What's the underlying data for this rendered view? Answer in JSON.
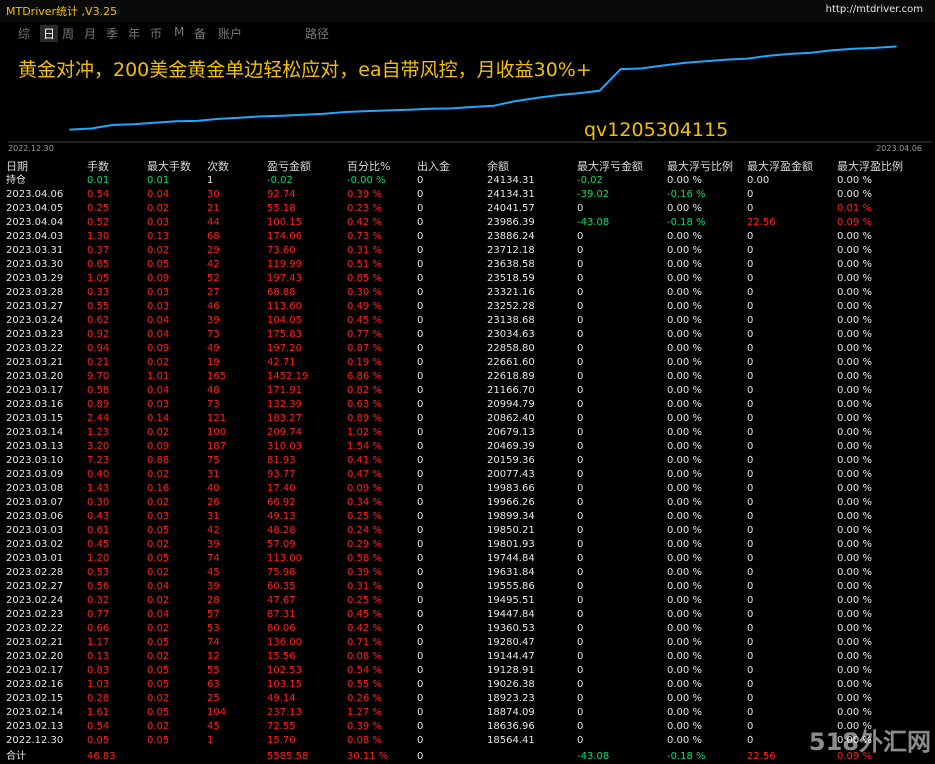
{
  "title": "MTDriver统计 ,V3.25",
  "site": "http://mtdriver.com",
  "tabs": [
    {
      "label": "综",
      "active": false
    },
    {
      "label": "日",
      "active": true
    },
    {
      "label": "周",
      "active": false
    },
    {
      "label": "月",
      "active": false
    },
    {
      "label": "季",
      "active": false
    },
    {
      "label": "年",
      "active": false
    },
    {
      "label": "币",
      "active": false
    },
    {
      "label": "M",
      "active": false
    },
    {
      "label": "备",
      "active": false
    },
    {
      "label": "账户",
      "active": false
    },
    {
      "label": "路径",
      "active": false
    }
  ],
  "chart": {
    "headline": "黄金对冲，200美金黄金单边轻松应对，ea自带风控，月收益30%+",
    "contact": "qv1205304115",
    "date_start": "2022.12.30",
    "date_end": "2023.04.06",
    "line_color": "#1ea8ff"
  },
  "chart_data": {
    "type": "line",
    "x": [
      "2022.12.30",
      "2023.02.13",
      "2023.02.14",
      "2023.02.15",
      "2023.02.16",
      "2023.02.17",
      "2023.02.20",
      "2023.02.21",
      "2023.02.22",
      "2023.02.23",
      "2023.02.24",
      "2023.02.27",
      "2023.02.28",
      "2023.03.01",
      "2023.03.02",
      "2023.03.03",
      "2023.03.06",
      "2023.03.07",
      "2023.03.08",
      "2023.03.09",
      "2023.03.10",
      "2023.03.13",
      "2023.03.14",
      "2023.03.15",
      "2023.03.16",
      "2023.03.17",
      "2023.03.20",
      "2023.03.21",
      "2023.03.22",
      "2023.03.23",
      "2023.03.24",
      "2023.03.27",
      "2023.03.28",
      "2023.03.29",
      "2023.03.30",
      "2023.03.31",
      "2023.04.03",
      "2023.04.04",
      "2023.04.05",
      "2023.04.06"
    ],
    "series": [
      {
        "values": [
          18564.41,
          18636.96,
          18874.09,
          18923.23,
          19026.38,
          19128.91,
          19144.47,
          19280.47,
          19360.53,
          19447.84,
          19495.51,
          19555.86,
          19631.84,
          19744.84,
          19801.93,
          19850.21,
          19899.34,
          19966.26,
          19983.66,
          20077.43,
          20159.36,
          20469.39,
          20679.13,
          20862.4,
          20994.79,
          21166.7,
          22618.89,
          22661.6,
          22858.8,
          23034.63,
          23138.68,
          23252.28,
          23321.16,
          23518.59,
          23638.58,
          23712.18,
          23886.24,
          23986.39,
          24041.57,
          24134.31
        ]
      }
    ]
  },
  "columns": [
    "日期",
    "手数",
    "最大手数",
    "次数",
    "盈亏金额",
    "百分比%",
    "出入金",
    "余额",
    "最大浮亏金额",
    "最大浮亏比例",
    "最大浮盈金额",
    "最大浮盈比例"
  ],
  "position_row": {
    "date": "持仓",
    "lots": "0.01",
    "max_lots": "0.01",
    "count": "1",
    "pnl": "-0.02",
    "pct": "-0.00 %",
    "io": "0",
    "balance": "24134.31",
    "max_dd_amt": "-0.02",
    "max_dd_pct": "0.00 %",
    "max_fp_amt": "0.00",
    "max_fp_pct": "0.00 %"
  },
  "rows": [
    {
      "date": "2023.04.06",
      "lots": "0.54",
      "max_lots": "0.04",
      "count": "30",
      "pnl": "92.74",
      "pct": "0.39 %",
      "io": "0",
      "balance": "24134.31",
      "max_dd_amt": "-39.02",
      "max_dd_pct": "-0.16 %",
      "max_fp_amt": "0",
      "max_fp_pct": "0.00 %"
    },
    {
      "date": "2023.04.05",
      "lots": "0.25",
      "max_lots": "0.02",
      "count": "21",
      "pnl": "55.18",
      "pct": "0.23 %",
      "io": "0",
      "balance": "24041.57",
      "max_dd_amt": "0",
      "max_dd_pct": "0.00 %",
      "max_fp_amt": "0",
      "max_fp_pct": "0.01 %"
    },
    {
      "date": "2023.04.04",
      "lots": "0.52",
      "max_lots": "0.03",
      "count": "44",
      "pnl": "100.15",
      "pct": "0.42 %",
      "io": "0",
      "balance": "23986.39",
      "max_dd_amt": "-43.08",
      "max_dd_pct": "-0.18 %",
      "max_fp_amt": "22.56",
      "max_fp_pct": "0.09 %"
    },
    {
      "date": "2023.04.03",
      "lots": "1.30",
      "max_lots": "0.13",
      "count": "68",
      "pnl": "174.06",
      "pct": "0.73 %",
      "io": "0",
      "balance": "23886.24",
      "max_dd_amt": "0",
      "max_dd_pct": "0.00 %",
      "max_fp_amt": "0",
      "max_fp_pct": "0.00 %"
    },
    {
      "date": "2023.03.31",
      "lots": "0.37",
      "max_lots": "0.02",
      "count": "29",
      "pnl": "73.60",
      "pct": "0.31 %",
      "io": "0",
      "balance": "23712.18",
      "max_dd_amt": "0",
      "max_dd_pct": "0.00 %",
      "max_fp_amt": "0",
      "max_fp_pct": "0.00 %"
    },
    {
      "date": "2023.03.30",
      "lots": "0.65",
      "max_lots": "0.05",
      "count": "42",
      "pnl": "119.99",
      "pct": "0.51 %",
      "io": "0",
      "balance": "23638.58",
      "max_dd_amt": "0",
      "max_dd_pct": "0.00 %",
      "max_fp_amt": "0",
      "max_fp_pct": "0.00 %"
    },
    {
      "date": "2023.03.29",
      "lots": "1.05",
      "max_lots": "0.09",
      "count": "52",
      "pnl": "197.43",
      "pct": "0.85 %",
      "io": "0",
      "balance": "23518.59",
      "max_dd_amt": "0",
      "max_dd_pct": "0.00 %",
      "max_fp_amt": "0",
      "max_fp_pct": "0.00 %"
    },
    {
      "date": "2023.03.28",
      "lots": "0.33",
      "max_lots": "0.03",
      "count": "27",
      "pnl": "68.88",
      "pct": "0.30 %",
      "io": "0",
      "balance": "23321.16",
      "max_dd_amt": "0",
      "max_dd_pct": "0.00 %",
      "max_fp_amt": "0",
      "max_fp_pct": "0.00 %"
    },
    {
      "date": "2023.03.27",
      "lots": "0.55",
      "max_lots": "0.03",
      "count": "46",
      "pnl": "113.60",
      "pct": "0.49 %",
      "io": "0",
      "balance": "23252.28",
      "max_dd_amt": "0",
      "max_dd_pct": "0.00 %",
      "max_fp_amt": "0",
      "max_fp_pct": "0.00 %"
    },
    {
      "date": "2023.03.24",
      "lots": "0.62",
      "max_lots": "0.04",
      "count": "39",
      "pnl": "104.05",
      "pct": "0.45 %",
      "io": "0",
      "balance": "23138.68",
      "max_dd_amt": "0",
      "max_dd_pct": "0.00 %",
      "max_fp_amt": "0",
      "max_fp_pct": "0.00 %"
    },
    {
      "date": "2023.03.23",
      "lots": "0.92",
      "max_lots": "0.04",
      "count": "73",
      "pnl": "175.83",
      "pct": "0.77 %",
      "io": "0",
      "balance": "23034.63",
      "max_dd_amt": "0",
      "max_dd_pct": "0.00 %",
      "max_fp_amt": "0",
      "max_fp_pct": "0.00 %"
    },
    {
      "date": "2023.03.22",
      "lots": "0.94",
      "max_lots": "0.09",
      "count": "49",
      "pnl": "197.20",
      "pct": "0.87 %",
      "io": "0",
      "balance": "22858.80",
      "max_dd_amt": "0",
      "max_dd_pct": "0.00 %",
      "max_fp_amt": "0",
      "max_fp_pct": "0.00 %"
    },
    {
      "date": "2023.03.21",
      "lots": "0.21",
      "max_lots": "0.02",
      "count": "19",
      "pnl": "42.71",
      "pct": "0.19 %",
      "io": "0",
      "balance": "22661.60",
      "max_dd_amt": "0",
      "max_dd_pct": "0.00 %",
      "max_fp_amt": "0",
      "max_fp_pct": "0.00 %"
    },
    {
      "date": "2023.03.20",
      "lots": "9.70",
      "max_lots": "1.01",
      "count": "165",
      "pnl": "1452.19",
      "pct": "6.86 %",
      "io": "0",
      "balance": "22618.89",
      "max_dd_amt": "0",
      "max_dd_pct": "0.00 %",
      "max_fp_amt": "0",
      "max_fp_pct": "0.00 %"
    },
    {
      "date": "2023.03.17",
      "lots": "0.58",
      "max_lots": "0.04",
      "count": "48",
      "pnl": "171.91",
      "pct": "0.82 %",
      "io": "0",
      "balance": "21166.70",
      "max_dd_amt": "0",
      "max_dd_pct": "0.00 %",
      "max_fp_amt": "0",
      "max_fp_pct": "0.00 %"
    },
    {
      "date": "2023.03.16",
      "lots": "0.89",
      "max_lots": "0.03",
      "count": "73",
      "pnl": "132.39",
      "pct": "0.63 %",
      "io": "0",
      "balance": "20994.79",
      "max_dd_amt": "0",
      "max_dd_pct": "0.00 %",
      "max_fp_amt": "0",
      "max_fp_pct": "0.00 %"
    },
    {
      "date": "2023.03.15",
      "lots": "2.44",
      "max_lots": "0.14",
      "count": "121",
      "pnl": "183.27",
      "pct": "0.89 %",
      "io": "0",
      "balance": "20862.40",
      "max_dd_amt": "0",
      "max_dd_pct": "0.00 %",
      "max_fp_amt": "0",
      "max_fp_pct": "0.00 %"
    },
    {
      "date": "2023.03.14",
      "lots": "1.23",
      "max_lots": "0.02",
      "count": "100",
      "pnl": "209.74",
      "pct": "1.02 %",
      "io": "0",
      "balance": "20679.13",
      "max_dd_amt": "0",
      "max_dd_pct": "0.00 %",
      "max_fp_amt": "0",
      "max_fp_pct": "0.00 %"
    },
    {
      "date": "2023.03.13",
      "lots": "3.20",
      "max_lots": "0.09",
      "count": "187",
      "pnl": "310.03",
      "pct": "1.54 %",
      "io": "0",
      "balance": "20469.39",
      "max_dd_amt": "0",
      "max_dd_pct": "0.00 %",
      "max_fp_amt": "0",
      "max_fp_pct": "0.00 %"
    },
    {
      "date": "2023.03.10",
      "lots": "7.23",
      "max_lots": "0.88",
      "count": "75",
      "pnl": "81.93",
      "pct": "0.41 %",
      "io": "0",
      "balance": "20159.36",
      "max_dd_amt": "0",
      "max_dd_pct": "0.00 %",
      "max_fp_amt": "0",
      "max_fp_pct": "0.00 %"
    },
    {
      "date": "2023.03.09",
      "lots": "0.40",
      "max_lots": "0.02",
      "count": "31",
      "pnl": "93.77",
      "pct": "0.47 %",
      "io": "0",
      "balance": "20077.43",
      "max_dd_amt": "0",
      "max_dd_pct": "0.00 %",
      "max_fp_amt": "0",
      "max_fp_pct": "0.00 %"
    },
    {
      "date": "2023.03.08",
      "lots": "1.43",
      "max_lots": "0.16",
      "count": "40",
      "pnl": "17.40",
      "pct": "0.09 %",
      "io": "0",
      "balance": "19983.66",
      "max_dd_amt": "0",
      "max_dd_pct": "0.00 %",
      "max_fp_amt": "0",
      "max_fp_pct": "0.00 %"
    },
    {
      "date": "2023.03.07",
      "lots": "0.30",
      "max_lots": "0.02",
      "count": "26",
      "pnl": "66.92",
      "pct": "0.34 %",
      "io": "0",
      "balance": "19966.26",
      "max_dd_amt": "0",
      "max_dd_pct": "0.00 %",
      "max_fp_amt": "0",
      "max_fp_pct": "0.00 %"
    },
    {
      "date": "2023.03.06",
      "lots": "0.43",
      "max_lots": "0.03",
      "count": "31",
      "pnl": "49.13",
      "pct": "0.25 %",
      "io": "0",
      "balance": "19899.34",
      "max_dd_amt": "0",
      "max_dd_pct": "0.00 %",
      "max_fp_amt": "0",
      "max_fp_pct": "0.00 %"
    },
    {
      "date": "2023.03.03",
      "lots": "0.61",
      "max_lots": "0.05",
      "count": "42",
      "pnl": "48.28",
      "pct": "0.24 %",
      "io": "0",
      "balance": "19850.21",
      "max_dd_amt": "0",
      "max_dd_pct": "0.00 %",
      "max_fp_amt": "0",
      "max_fp_pct": "0.00 %"
    },
    {
      "date": "2023.03.02",
      "lots": "0.45",
      "max_lots": "0.02",
      "count": "39",
      "pnl": "57.09",
      "pct": "0.29 %",
      "io": "0",
      "balance": "19801.93",
      "max_dd_amt": "0",
      "max_dd_pct": "0.00 %",
      "max_fp_amt": "0",
      "max_fp_pct": "0.00 %"
    },
    {
      "date": "2023.03.01",
      "lots": "1.20",
      "max_lots": "0.05",
      "count": "74",
      "pnl": "113.00",
      "pct": "0.58 %",
      "io": "0",
      "balance": "19744.84",
      "max_dd_amt": "0",
      "max_dd_pct": "0.00 %",
      "max_fp_amt": "0",
      "max_fp_pct": "0.00 %"
    },
    {
      "date": "2023.02.28",
      "lots": "0.53",
      "max_lots": "0.02",
      "count": "45",
      "pnl": "75.98",
      "pct": "0.39 %",
      "io": "0",
      "balance": "19631.84",
      "max_dd_amt": "0",
      "max_dd_pct": "0.00 %",
      "max_fp_amt": "0",
      "max_fp_pct": "0.00 %"
    },
    {
      "date": "2023.02.27",
      "lots": "0.56",
      "max_lots": "0.04",
      "count": "39",
      "pnl": "60.35",
      "pct": "0.31 %",
      "io": "0",
      "balance": "19555.86",
      "max_dd_amt": "0",
      "max_dd_pct": "0.00 %",
      "max_fp_amt": "0",
      "max_fp_pct": "0.00 %"
    },
    {
      "date": "2023.02.24",
      "lots": "0.32",
      "max_lots": "0.02",
      "count": "28",
      "pnl": "47.67",
      "pct": "0.25 %",
      "io": "0",
      "balance": "19495.51",
      "max_dd_amt": "0",
      "max_dd_pct": "0.00 %",
      "max_fp_amt": "0",
      "max_fp_pct": "0.00 %"
    },
    {
      "date": "2023.02.23",
      "lots": "0.77",
      "max_lots": "0.04",
      "count": "57",
      "pnl": "87.31",
      "pct": "0.45 %",
      "io": "0",
      "balance": "19447.84",
      "max_dd_amt": "0",
      "max_dd_pct": "0.00 %",
      "max_fp_amt": "0",
      "max_fp_pct": "0.00 %"
    },
    {
      "date": "2023.02.22",
      "lots": "0.66",
      "max_lots": "0.02",
      "count": "53",
      "pnl": "80.06",
      "pct": "0.42 %",
      "io": "0",
      "balance": "19360.53",
      "max_dd_amt": "0",
      "max_dd_pct": "0.00 %",
      "max_fp_amt": "0",
      "max_fp_pct": "0.00 %"
    },
    {
      "date": "2023.02.21",
      "lots": "1.17",
      "max_lots": "0.05",
      "count": "74",
      "pnl": "136.00",
      "pct": "0.71 %",
      "io": "0",
      "balance": "19280.47",
      "max_dd_amt": "0",
      "max_dd_pct": "0.00 %",
      "max_fp_amt": "0",
      "max_fp_pct": "0.00 %"
    },
    {
      "date": "2023.02.20",
      "lots": "0.13",
      "max_lots": "0.02",
      "count": "12",
      "pnl": "15.56",
      "pct": "0.08 %",
      "io": "0",
      "balance": "19144.47",
      "max_dd_amt": "0",
      "max_dd_pct": "0.00 %",
      "max_fp_amt": "0",
      "max_fp_pct": "0.00 %"
    },
    {
      "date": "2023.02.17",
      "lots": "0.83",
      "max_lots": "0.05",
      "count": "55",
      "pnl": "102.53",
      "pct": "0.54 %",
      "io": "0",
      "balance": "19128.91",
      "max_dd_amt": "0",
      "max_dd_pct": "0.00 %",
      "max_fp_amt": "0",
      "max_fp_pct": "0.00 %"
    },
    {
      "date": "2023.02.16",
      "lots": "1.03",
      "max_lots": "0.05",
      "count": "63",
      "pnl": "103.15",
      "pct": "0.55 %",
      "io": "0",
      "balance": "19026.38",
      "max_dd_amt": "0",
      "max_dd_pct": "0.00 %",
      "max_fp_amt": "0",
      "max_fp_pct": "0.00 %"
    },
    {
      "date": "2023.02.15",
      "lots": "0.28",
      "max_lots": "0.02",
      "count": "25",
      "pnl": "49.14",
      "pct": "0.26 %",
      "io": "0",
      "balance": "18923.23",
      "max_dd_amt": "0",
      "max_dd_pct": "0.00 %",
      "max_fp_amt": "0",
      "max_fp_pct": "0.00 %"
    },
    {
      "date": "2023.02.14",
      "lots": "1.61",
      "max_lots": "0.05",
      "count": "104",
      "pnl": "237.13",
      "pct": "1.27 %",
      "io": "0",
      "balance": "18874.09",
      "max_dd_amt": "0",
      "max_dd_pct": "0.00 %",
      "max_fp_amt": "0",
      "max_fp_pct": "0.00 %"
    },
    {
      "date": "2023.02.13",
      "lots": "0.54",
      "max_lots": "0.02",
      "count": "45",
      "pnl": "72.55",
      "pct": "0.39 %",
      "io": "0",
      "balance": "18636.96",
      "max_dd_amt": "0",
      "max_dd_pct": "0.00 %",
      "max_fp_amt": "0",
      "max_fp_pct": "0.00 %"
    },
    {
      "date": "2022.12.30",
      "lots": "0.05",
      "max_lots": "0.05",
      "count": "1",
      "pnl": "15.70",
      "pct": "0.08 %",
      "io": "0",
      "balance": "18564.41",
      "max_dd_amt": "0",
      "max_dd_pct": "0.00 %",
      "max_fp_amt": "0",
      "max_fp_pct": "0.00 %"
    }
  ],
  "total_row": {
    "date": "合计",
    "lots": "46.83",
    "max_lots": "",
    "count": "",
    "pnl": "5585.58",
    "pct": "30.11 %",
    "io": "0",
    "balance": "",
    "max_dd_amt": "-43.08",
    "max_dd_pct": "-0.18 %",
    "max_fp_amt": "22.56",
    "max_fp_pct": "0.09 %"
  },
  "watermark": "518外汇网"
}
